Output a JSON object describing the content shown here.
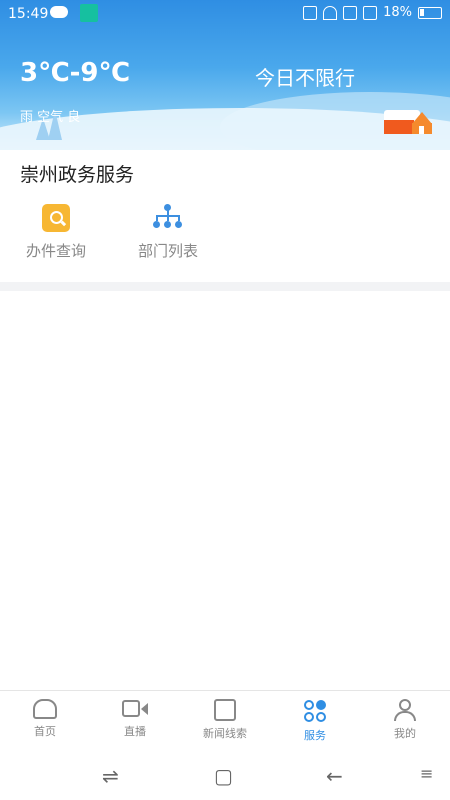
{
  "statusbar": {
    "time": "15:49",
    "battery": "18%"
  },
  "header": {
    "temperature": "3℃-9℃",
    "traffic_restriction": "今日不限行",
    "air_quality": "雨 空气 良"
  },
  "services": {
    "title": "崇州政务服务",
    "items": [
      {
        "label": "办件查询",
        "icon": "search-doc-icon"
      },
      {
        "label": "部门列表",
        "icon": "org-chart-icon"
      }
    ]
  },
  "bottom_nav": {
    "items": [
      {
        "label": "首页",
        "icon": "home-icon"
      },
      {
        "label": "直播",
        "icon": "video-icon"
      },
      {
        "label": "新闻线索",
        "icon": "edit-icon"
      },
      {
        "label": "服务",
        "icon": "grid-icon",
        "active": true
      },
      {
        "label": "我的",
        "icon": "user-icon"
      }
    ]
  },
  "system_nav": {
    "switch": "⇌",
    "home": "▢",
    "back": "←",
    "menu": "≡"
  },
  "colors": {
    "accent": "#2f8ee3",
    "warning": "#f7b733"
  }
}
